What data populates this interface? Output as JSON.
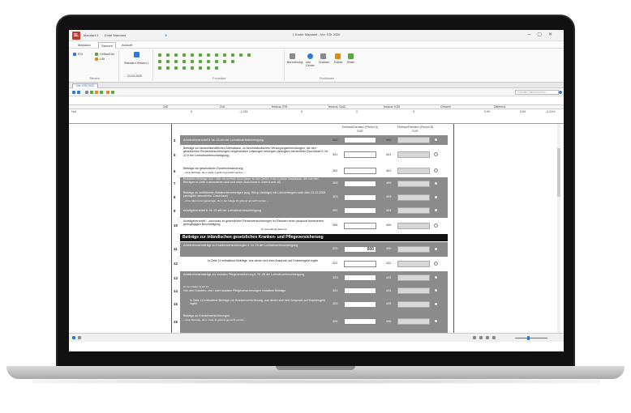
{
  "window": {
    "app_logo": "SL",
    "tabs": [
      "Mandant 1",
      "Erste Mandant"
    ],
    "title": "1 Erster Mandant - Vor. ESt 2020"
  },
  "ribbon": {
    "tabs": [
      "Mandant",
      "Steuern",
      "Ansicht"
    ],
    "active_tab": "Steuern",
    "groups": {
      "steuern": {
        "label": "Steuern",
        "items": [
          "ESt",
          "GrSteuErkl.",
          "USt"
        ]
      },
      "jahr": {
        "items": [
          "Standard Version 1",
          "23.04.2020"
        ]
      },
      "formulare": {
        "label": "Formulare"
      },
      "funktionen": {
        "label": "Funktionen",
        "items": [
          "Berechnung",
          "Info Center",
          "Drucken",
          "Extras",
          "Elster"
        ]
      }
    }
  },
  "doc_tab": {
    "label": "Vor. ESt 2020"
  },
  "search": {
    "placeholder": "Virtuelle Dienst suchen"
  },
  "summary": {
    "headers": [
      "ZvE",
      "ZvE",
      "festzus. ESt",
      "festzus. SolZ",
      "festzus. KiSt",
      "Gesamt",
      "Differenz"
    ],
    "row_label": "Vorl.",
    "values": [
      "0",
      "-1.239",
      "0",
      "0",
      "0",
      "0,00",
      "0,00",
      "-0,01%"
    ]
  },
  "form": {
    "col_heads": [
      "Ehefrau/Ehemann (Person A)",
      "Ehefrau/Ehemann (Person B)"
    ],
    "col_unit": "EUR",
    "rows": [
      {
        "num": "4",
        "text": "Arbeitnehmeranteil lt. Nr. 23 a/b der Lohnsteuerbescheinigung",
        "code": "300",
        "code_b": "400"
      },
      {
        "num": "5",
        "text": "Beiträge zur landwirtschaftlichen Alterskasse, zu berufsständischen Versorgungseinrichtungen, die den gesetzlichen Rentenversicherungen vergleichbare Leistungen erbringen (abzüglich steuerfreier Zuschüsse lt. Nr. 22 b der Lohnsteuerbescheinigung)",
        "sub": "– ohne Beiträge, die in Zeile 4 geltend gemacht werden –",
        "code": "301",
        "code_b": "401"
      },
      {
        "num": "6",
        "text": "Beiträge zur gesetzlichen Rentenversicherung",
        "sub": "– ohne Beiträge, die in Zeile 4 geltend gemacht werden –",
        "code": "302",
        "code_b": "402"
      },
      {
        "num": "7",
        "text": "Erstattete Beiträge und / oder steuerfreie Zuschüsse zu den Zeilen 4 bis 6 (ohne Zuschüsse, die von den Beträgen in Zeile 4 abzuziehen sind und ohne Zuschüsse lt. Zeile 8 und 10)",
        "code": "309",
        "code_b": "409"
      },
      {
        "num": "8",
        "text": "Beiträge zu zertifizierten Basisrentenverträgen (sog. Rürup-Verträge) mit Laufzeitbeginn nach dem 31.12.2004 (abzüglich steuerfreier Zuschüsse)",
        "sub": "– ohne Altersvorsorgebeiträge, die in der Anlage AV geltend gemacht werden –",
        "code": "303",
        "code_b": "403"
      },
      {
        "num": "9",
        "text": "Arbeitgeberanteil lt. Nr. 22 a/b der Lohnsteuerbescheinigung",
        "code": "304",
        "code_b": "404"
      },
      {
        "num": "10",
        "text": "Arbeitgeberanteil / -zuschuss zu gesetzlichen Rentenversicherungen im Rahmen einer pauschal besteuerten geringfügigen Beschäftigung",
        "sub": "(lt. Anmeldung Steuern)",
        "code": "306",
        "code_b": "406"
      },
      {
        "num": "11",
        "text": "Arbeitnehmerbeiträge zu Krankenversicherungen lt. Nr. 25 der Lohnsteuerbescheinigung",
        "code": "320",
        "code_b": "420",
        "value": "600"
      },
      {
        "num": "12",
        "text": "In Zeile 11 enthaltene Beiträge, aus denen sich kein Anspruch auf Krankengeld ergibt",
        "code": "322",
        "code_b": "422"
      },
      {
        "num": "13",
        "text": "Arbeitnehmerbeiträge zur sozialen Pflegeversicherung lt. Nr. 26 der Lohnsteuerbescheinigung",
        "code": "323",
        "code_b": "423"
      },
      {
        "num": "14",
        "text": "Von den Kranken- und / oder sozialen Pflegeversicherungen erstattete Beiträge",
        "sub": "Zu den Zeilen 11 bis 13",
        "code": "324",
        "code_b": "424"
      },
      {
        "num": "15",
        "text": "In Zeile 14 enthaltene Beiträge zur Krankenversicherung, aus denen sich kein Anspruch auf Krankengeld ergibt",
        "code": "325",
        "code_b": "425"
      },
      {
        "num": "16",
        "text": "Beiträge zu Krankenversicherungen",
        "sub": "– ohne Beiträge, die in Zeile 11 geltend gemacht werden –",
        "code": "326",
        "code_b": "426"
      }
    ],
    "section_title": "Beiträge zur inländischen gesetzlichen Kranken- und Pflegeversicherung"
  }
}
